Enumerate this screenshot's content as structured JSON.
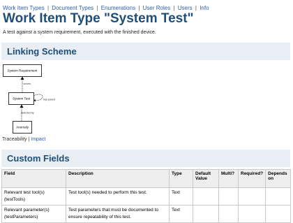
{
  "nav": {
    "items": [
      "Work Item Types",
      "Document Types",
      "Enumerations",
      "User Roles",
      "Users",
      "Info"
    ],
    "separator": "|"
  },
  "page": {
    "title": "Work Item Type \"System Test\"",
    "description": "A test against a system requirement, executed with the finished device."
  },
  "linking": {
    "heading": "Linking Scheme",
    "diagram": {
      "nodes": [
        "System Requirement",
        "System Test",
        "Anomaly"
      ],
      "edges": [
        "covers",
        "has parent",
        "detected by"
      ]
    },
    "links": {
      "traceability": "Traceability",
      "separator": "|",
      "impact": "Impact"
    }
  },
  "custom_fields": {
    "heading": "Custom Fields",
    "columns": [
      "Field",
      "Description",
      "Type",
      "Default Value",
      "Multi?",
      "Required?",
      "Depends on"
    ],
    "rows": [
      {
        "field": "Relevant test tool(s) (testTools)",
        "description": "Test tool(s) needed to perform this test.",
        "type": "Text",
        "default": "",
        "multi": "",
        "required": "",
        "depends": ""
      },
      {
        "field": "Relevant parameter(s) (testParameters)",
        "description": "Test parameters that must be documented to ensure repeatability of this test.",
        "type": "Text",
        "default": "",
        "multi": "",
        "required": "",
        "depends": ""
      }
    ]
  }
}
